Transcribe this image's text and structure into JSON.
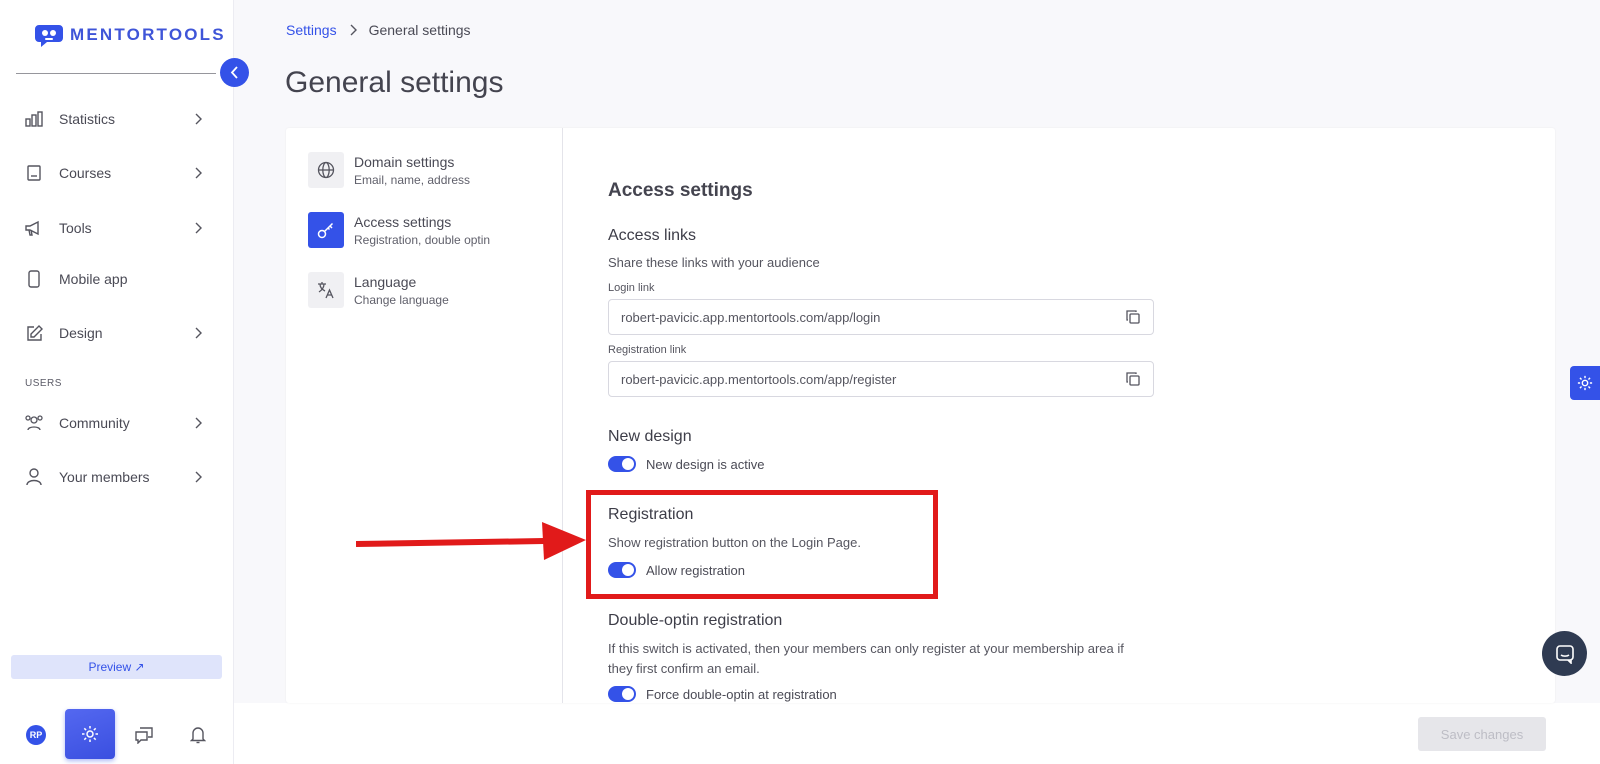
{
  "brand": {
    "name": "MENTORTOOLS"
  },
  "sidebar": {
    "items": [
      {
        "label": "Statistics",
        "icon": "bar-chart-icon",
        "has_chevron": true
      },
      {
        "label": "Courses",
        "icon": "book-icon",
        "has_chevron": true
      },
      {
        "label": "Tools",
        "icon": "megaphone-icon",
        "has_chevron": true
      },
      {
        "label": "Mobile app",
        "icon": "phone-icon",
        "has_chevron": false
      },
      {
        "label": "Design",
        "icon": "pen-icon",
        "has_chevron": true
      }
    ],
    "users_section_label": "USERS",
    "user_items": [
      {
        "label": "Community",
        "icon": "people-icon",
        "has_chevron": true
      },
      {
        "label": "Your members",
        "icon": "person-icon",
        "has_chevron": true
      }
    ],
    "preview_label": "Preview ↗",
    "avatar_initials": "RP"
  },
  "breadcrumb": {
    "parent": "Settings",
    "current": "General settings"
  },
  "page_title": "General settings",
  "settings_nav": [
    {
      "title": "Domain settings",
      "subtitle": "Email, name, address",
      "icon": "globe-icon",
      "active": false
    },
    {
      "title": "Access settings",
      "subtitle": "Registration, double optin",
      "icon": "key-icon",
      "active": true
    },
    {
      "title": "Language",
      "subtitle": "Change language",
      "icon": "translate-icon",
      "active": false
    }
  ],
  "access": {
    "section_title": "Access settings",
    "links_title": "Access links",
    "links_desc": "Share these links with your audience",
    "login_label": "Login link",
    "login_value": "robert-pavicic.app.mentortools.com/app/login",
    "register_label": "Registration link",
    "register_value": "robert-pavicic.app.mentortools.com/app/register",
    "new_design_title": "New design",
    "new_design_toggle": "New design is active",
    "registration_title": "Registration",
    "registration_desc": "Show registration button on the Login Page.",
    "registration_toggle": "Allow registration",
    "double_optin_title": "Double-optin registration",
    "double_optin_desc": "If this switch is activated, then your members can only register at your membership area if they first confirm an email.",
    "double_optin_toggle": "Force double-optin at registration"
  },
  "save_label": "Save changes",
  "colors": {
    "accent": "#3452e8",
    "highlight": "#e11a1a"
  }
}
